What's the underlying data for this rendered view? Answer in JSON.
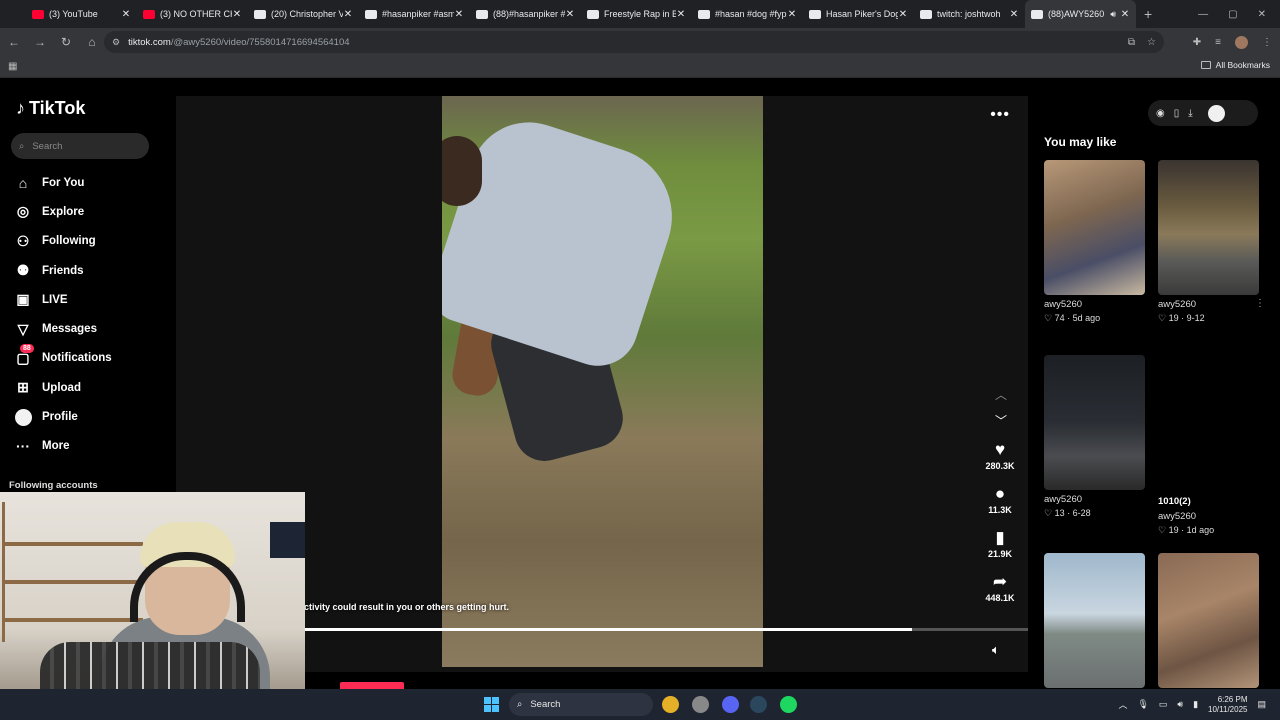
{
  "browser": {
    "tabs": [
      {
        "label": "(3) YouTube",
        "icon": "youtube-icon",
        "color": "#ff0033"
      },
      {
        "label": "(3) NO OTHER CH",
        "icon": "youtube-icon",
        "color": "#ff0033"
      },
      {
        "label": "(20) Christopher V",
        "icon": "x-icon",
        "color": "#e8eaed"
      },
      {
        "label": "#hasanpiker #asm",
        "icon": "tiktok-icon",
        "color": "#e8eaed"
      },
      {
        "label": "(88)#hasanpiker #",
        "icon": "tiktok-icon",
        "color": "#e8eaed"
      },
      {
        "label": "Freestyle Rap in B",
        "icon": "tiktok-icon",
        "color": "#e8eaed"
      },
      {
        "label": "#hasan #dog #fyp",
        "icon": "tiktok-icon",
        "color": "#e8eaed"
      },
      {
        "label": "Hasan Piker's Dog",
        "icon": "tiktok-icon",
        "color": "#e8eaed"
      },
      {
        "label": "twitch: joshtwoh",
        "icon": "tiktok-icon",
        "color": "#e8eaed"
      },
      {
        "label": "(88)AWY5260",
        "icon": "tiktok-icon",
        "color": "#e8eaed",
        "active": true
      }
    ],
    "url_host": "tiktok.com",
    "url_path": "/@awy5260/video/7558014716694564104",
    "all_bookmarks": "All Bookmarks"
  },
  "sidebar": {
    "logo_text": "TikTok",
    "search_placeholder": "Search",
    "items": [
      {
        "label": "For You",
        "icon": "home-icon",
        "glyph": "⌂"
      },
      {
        "label": "Explore",
        "icon": "compass-icon",
        "glyph": "◎"
      },
      {
        "label": "Following",
        "icon": "following-icon",
        "glyph": "⚇"
      },
      {
        "label": "Friends",
        "icon": "friends-icon",
        "glyph": "⚉"
      },
      {
        "label": "LIVE",
        "icon": "live-icon",
        "glyph": "▣"
      },
      {
        "label": "Messages",
        "icon": "messages-icon",
        "glyph": "▽"
      },
      {
        "label": "Notifications",
        "icon": "notifications-icon",
        "glyph": "▢",
        "badge": "88"
      },
      {
        "label": "Upload",
        "icon": "upload-icon",
        "glyph": "⊞"
      },
      {
        "label": "Profile",
        "icon": "profile-icon",
        "glyph": ""
      },
      {
        "label": "More",
        "icon": "more-icon",
        "glyph": "···"
      }
    ],
    "following_accounts": "Following accounts"
  },
  "player": {
    "caption": "ctivity could result in you or others getting hurt.",
    "progress": 0.84,
    "actions": [
      {
        "name": "like",
        "icon": "heart-icon",
        "glyph": "♥",
        "count": "280.3K"
      },
      {
        "name": "comment",
        "icon": "comment-icon",
        "glyph": "●",
        "count": "11.3K"
      },
      {
        "name": "favorite",
        "icon": "bookmark-icon",
        "glyph": "▮",
        "count": "21.9K"
      },
      {
        "name": "share",
        "icon": "share-icon",
        "glyph": "➦",
        "count": "448.1K"
      }
    ]
  },
  "right": {
    "title": "You may like",
    "cards": [
      {
        "title": "",
        "author": "awy5260",
        "likes": "74",
        "date": "5d ago",
        "thumb": "linear-gradient(160deg,#b89878 0%,#7d6650 40%,#4a4e66 70%,#c9b9a0 100%)"
      },
      {
        "title": "",
        "author": "awy5260",
        "likes": "19",
        "date": "9-12",
        "thumb": "linear-gradient(180deg,#3a3430 0%,#6b5c40 35%,#8a7a5a 55%,#5a5a58 75%,#3a3a3a 100%)"
      },
      {
        "title": "",
        "author": "awy5260",
        "likes": "13",
        "date": "6-28",
        "thumb": "linear-gradient(180deg,#1c1f24 0%,#2a2d33 50%,#4a4c50 75%,#2a2a2a 100%)"
      },
      {
        "title": "1010(2)",
        "author": "awy5260",
        "likes": "19",
        "date": "1d ago",
        "thumb": ""
      },
      {
        "title": "",
        "author": "",
        "likes": "",
        "date": "",
        "thumb": "linear-gradient(180deg,#9fb8cc 0%,#c9d6e0 45%,#7f8a85 60%,#6b6f70 100%)"
      },
      {
        "title": "",
        "author": "",
        "likes": "",
        "date": "",
        "thumb": "linear-gradient(160deg,#8a6a55 0%,#a88568 40%,#6e5544 70%,#b29478 100%)"
      }
    ]
  },
  "taskbar": {
    "search_label": "Search",
    "time": "6:26 PM",
    "date": "10/11/2025",
    "apps": [
      {
        "icon": "chrome-icon",
        "color": "#e4b028"
      },
      {
        "icon": "app-icon",
        "color": "#888888"
      },
      {
        "icon": "discord-icon",
        "color": "#5865f2"
      },
      {
        "icon": "steam-icon",
        "color": "#2a475e"
      },
      {
        "icon": "spotify-icon",
        "color": "#1ed760"
      }
    ]
  }
}
